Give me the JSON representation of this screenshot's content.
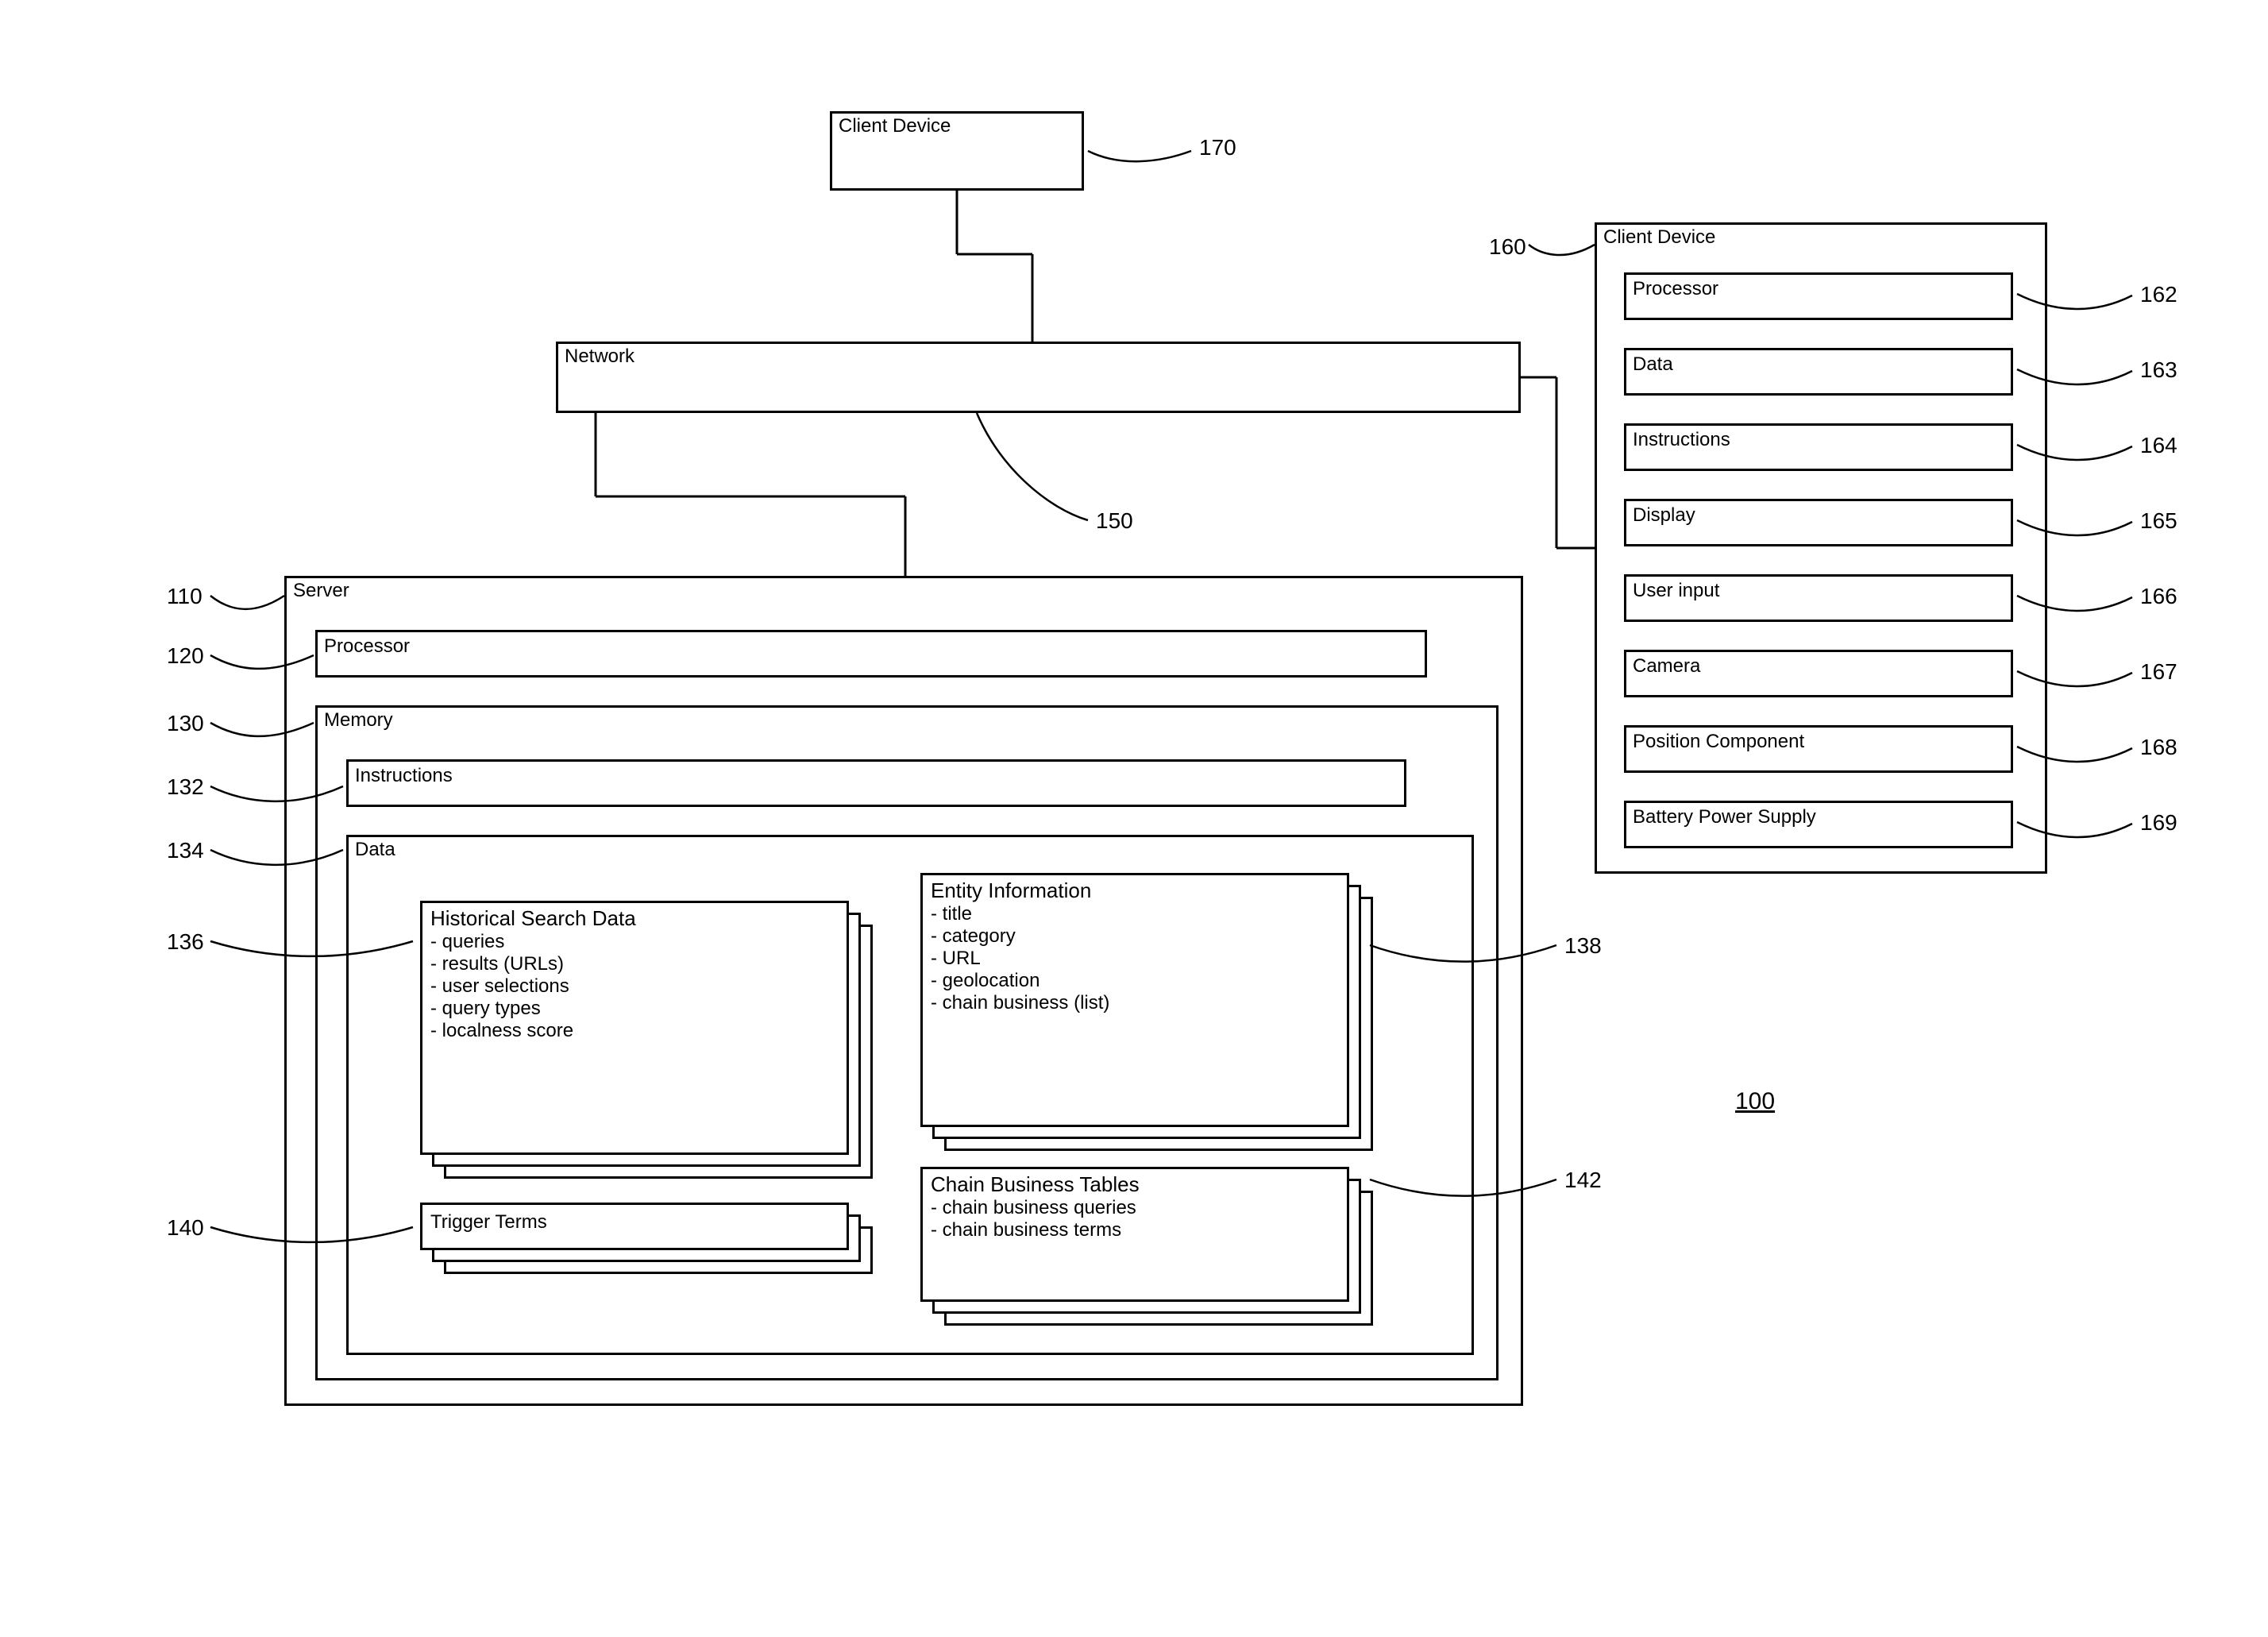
{
  "fig_ref": "100",
  "client_top": {
    "label": "Client Device",
    "ref": "170"
  },
  "network": {
    "label": "Network",
    "ref": "150"
  },
  "server": {
    "label": "Server",
    "ref": "110",
    "processor": {
      "label": "Processor",
      "ref": "120"
    },
    "memory": {
      "label": "Memory",
      "ref": "130",
      "instructions": {
        "label": "Instructions",
        "ref": "132"
      },
      "data": {
        "label": "Data",
        "ref": "134",
        "hist": {
          "title": "Historical Search Data",
          "ref": "136",
          "items": [
            "- queries",
            "- results (URLs)",
            "- user selections",
            "- query types",
            "- localness score"
          ]
        },
        "entity": {
          "title": "Entity Information",
          "ref": "138",
          "items": [
            "- title",
            "- category",
            "- URL",
            "- geolocation",
            "- chain business (list)"
          ]
        },
        "trigger": {
          "title": "Trigger Terms",
          "ref": "140"
        },
        "chain": {
          "title": "Chain Business Tables",
          "ref": "142",
          "items": [
            "- chain business queries",
            "- chain business terms"
          ]
        }
      }
    }
  },
  "client_right": {
    "label": "Client Device",
    "ref": "160",
    "rows": [
      {
        "label": "Processor",
        "ref": "162"
      },
      {
        "label": "Data",
        "ref": "163"
      },
      {
        "label": "Instructions",
        "ref": "164"
      },
      {
        "label": "Display",
        "ref": "165"
      },
      {
        "label": "User input",
        "ref": "166"
      },
      {
        "label": "Camera",
        "ref": "167"
      },
      {
        "label": "Position Component",
        "ref": "168"
      },
      {
        "label": "Battery Power Supply",
        "ref": "169"
      }
    ]
  }
}
